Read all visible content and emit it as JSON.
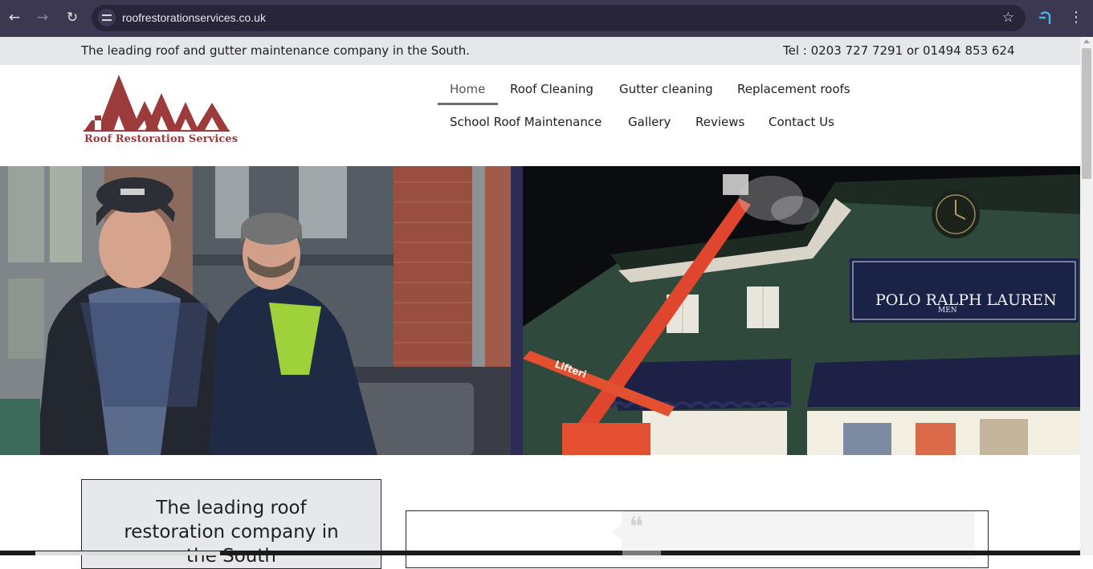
{
  "browser": {
    "url": "roofrestorationservices.co.uk"
  },
  "topbar": {
    "tagline": "The leading roof and gutter maintenance company in the South.",
    "phone": "Tel : 0203 727 7291 or 01494 853 624"
  },
  "logo": {
    "text": "Roof Restoration Services",
    "color": "#9b3b3b"
  },
  "nav": {
    "home": "Home",
    "roof_cleaning": "Roof Cleaning",
    "gutter_cleaning": "Gutter cleaning",
    "replacement_roofs": "Replacement roofs",
    "school_roof": "School Roof Maintenance",
    "gallery": "Gallery",
    "reviews": "Reviews",
    "contact": "Contact Us"
  },
  "hero": {
    "left_image": "workers-photo",
    "right_image": "night-cleaning-photo",
    "store_sign_line1": "POLO RALPH LAUREN",
    "store_sign_line2": "MEN",
    "lift_brand": "Lifteri"
  },
  "intro": {
    "heading_line1": "The leading roof",
    "heading_line2": "restoration company in",
    "heading_line3": "the South"
  },
  "testimonial": {
    "quote_icon": "quote-icon"
  }
}
